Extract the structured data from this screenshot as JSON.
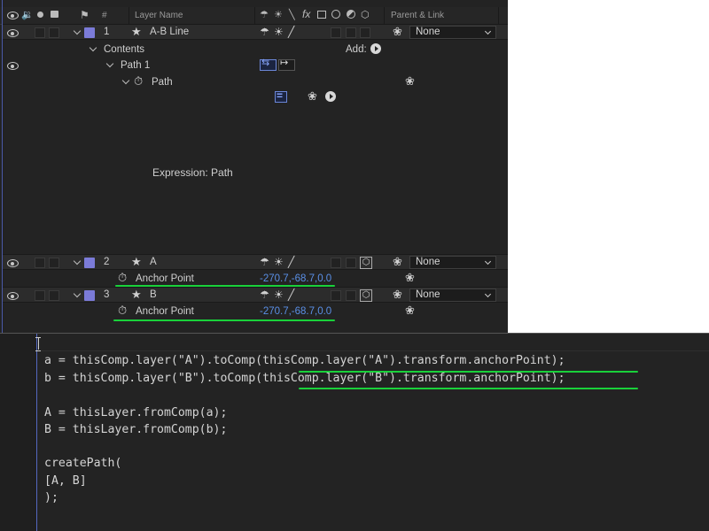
{
  "timeline": {
    "header": {
      "layer_name": "Layer Name",
      "number": "#",
      "parent_link": "Parent & Link",
      "fx": "fx"
    },
    "layers": [
      {
        "number": "1",
        "name": "A-B Line",
        "parent": "None"
      },
      {
        "number": "2",
        "name": "A",
        "parent": "None"
      },
      {
        "number": "3",
        "name": "B",
        "parent": "None"
      }
    ],
    "contents": {
      "label": "Contents",
      "add_label": "Add:"
    },
    "path1": {
      "label": "Path 1"
    },
    "path": {
      "label": "Path"
    },
    "expression_label": "Expression: Path",
    "anchor_a": {
      "label": "Anchor Point",
      "value": "-270.7,-68.7,0.0"
    },
    "anchor_b": {
      "label": "Anchor Point",
      "value": "-270.7,-68.7,0.0"
    },
    "colors": {
      "label": "#7b7bd8",
      "value": "#5a8fe6",
      "highlight": "#19d13a"
    }
  },
  "editor": {
    "lines": [
      "a = thisComp.layer(\"A\").toComp(thisComp.layer(\"A\").transform.anchorPoint);",
      "b = thisComp.layer(\"B\").toComp(thisComp.layer(\"B\").transform.anchorPoint);",
      "",
      "A = thisLayer.fromComp(a);",
      "B = thisLayer.fromComp(b);",
      "",
      "createPath(",
      "[A, B]",
      ");"
    ]
  }
}
